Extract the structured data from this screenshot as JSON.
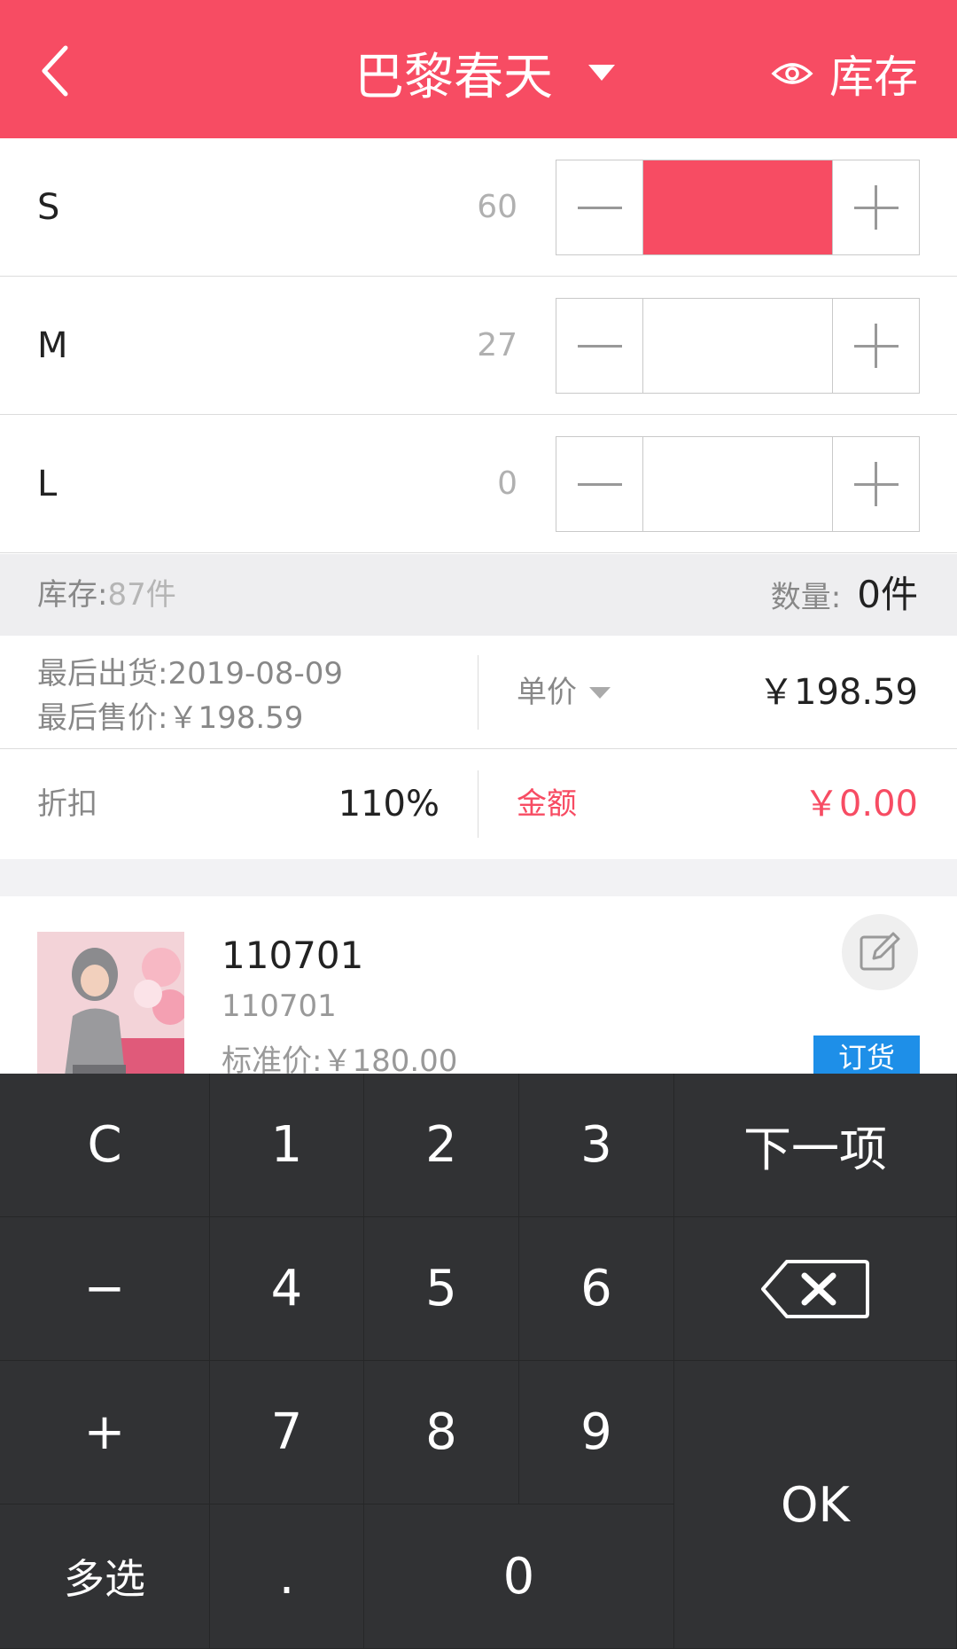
{
  "header": {
    "title": "巴黎春天",
    "stock_label": "库存"
  },
  "sizes": [
    {
      "label": "S",
      "stock": "60",
      "quantity": ""
    },
    {
      "label": "M",
      "stock": "27",
      "quantity": ""
    },
    {
      "label": "L",
      "stock": "0",
      "quantity": ""
    }
  ],
  "summary": {
    "stock_label": "库存:",
    "stock_value": "87件",
    "qty_label": "数量:",
    "qty_value": "0件"
  },
  "info": {
    "last_shipped_label": "最后出货:",
    "last_shipped_value": "2019-08-09",
    "last_price_label": "最后售价:",
    "last_price_value": "￥198.59",
    "unit_price_label": "单价",
    "unit_price_value": "￥198.59",
    "discount_label": "折扣",
    "discount_value": "110%",
    "amount_label": "金额",
    "amount_value": "￥0.00"
  },
  "product": {
    "code": "110701",
    "sub_code": "110701",
    "std_price_label": "标准价:",
    "std_price_value": "￥180.00",
    "tag": "订货"
  },
  "keypad": {
    "clear": "C",
    "k1": "1",
    "k2": "2",
    "k3": "3",
    "next": "下一项",
    "minus": "−",
    "k4": "4",
    "k5": "5",
    "k6": "6",
    "plus": "+",
    "k7": "7",
    "k8": "8",
    "k9": "9",
    "ok": "OK",
    "multi": "多选",
    "dot": ".",
    "k0": "0"
  },
  "colors": {
    "brand": "#f74c63",
    "tag_blue": "#1e8fe8",
    "keypad_bg": "#313234"
  },
  "icons": [
    "back-chevron-icon",
    "dropdown-caret-icon",
    "eye-icon",
    "minus-icon",
    "plus-icon",
    "edit-icon",
    "backspace-icon"
  ]
}
